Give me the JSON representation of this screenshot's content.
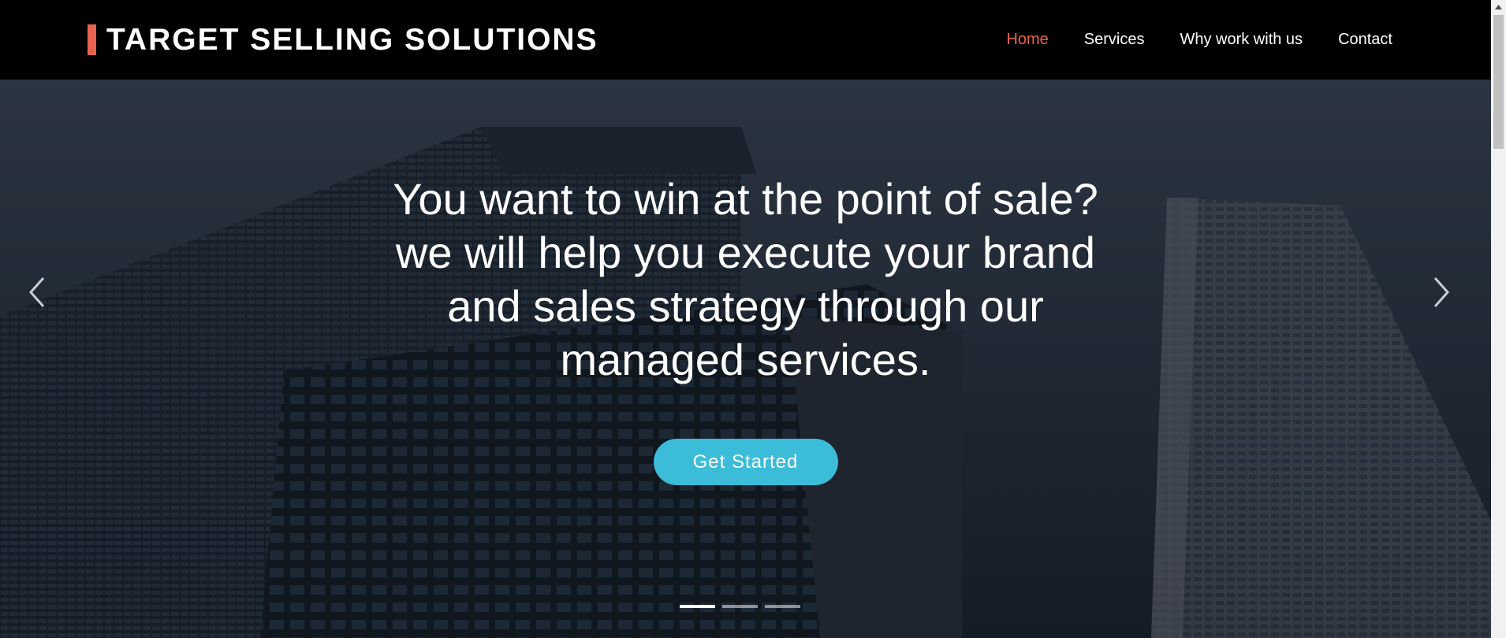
{
  "header": {
    "brand": "TARGET SELLING SOLUTIONS",
    "nav": [
      {
        "label": "Home",
        "active": true
      },
      {
        "label": "Services",
        "active": false
      },
      {
        "label": "Why work with us",
        "active": false
      },
      {
        "label": "Contact",
        "active": false
      }
    ]
  },
  "hero": {
    "headline_lines": [
      "You want to win at the point of sale?",
      "we will help you execute your brand",
      "and sales strategy through our",
      "managed services."
    ],
    "cta_label": "Get Started",
    "slides_total": 3,
    "active_slide": 1,
    "prev_icon": "chevron-left-icon",
    "next_icon": "chevron-right-icon"
  },
  "colors": {
    "accent": "#e8624f",
    "cta": "#3bbcd8",
    "header_bg": "#000000"
  }
}
